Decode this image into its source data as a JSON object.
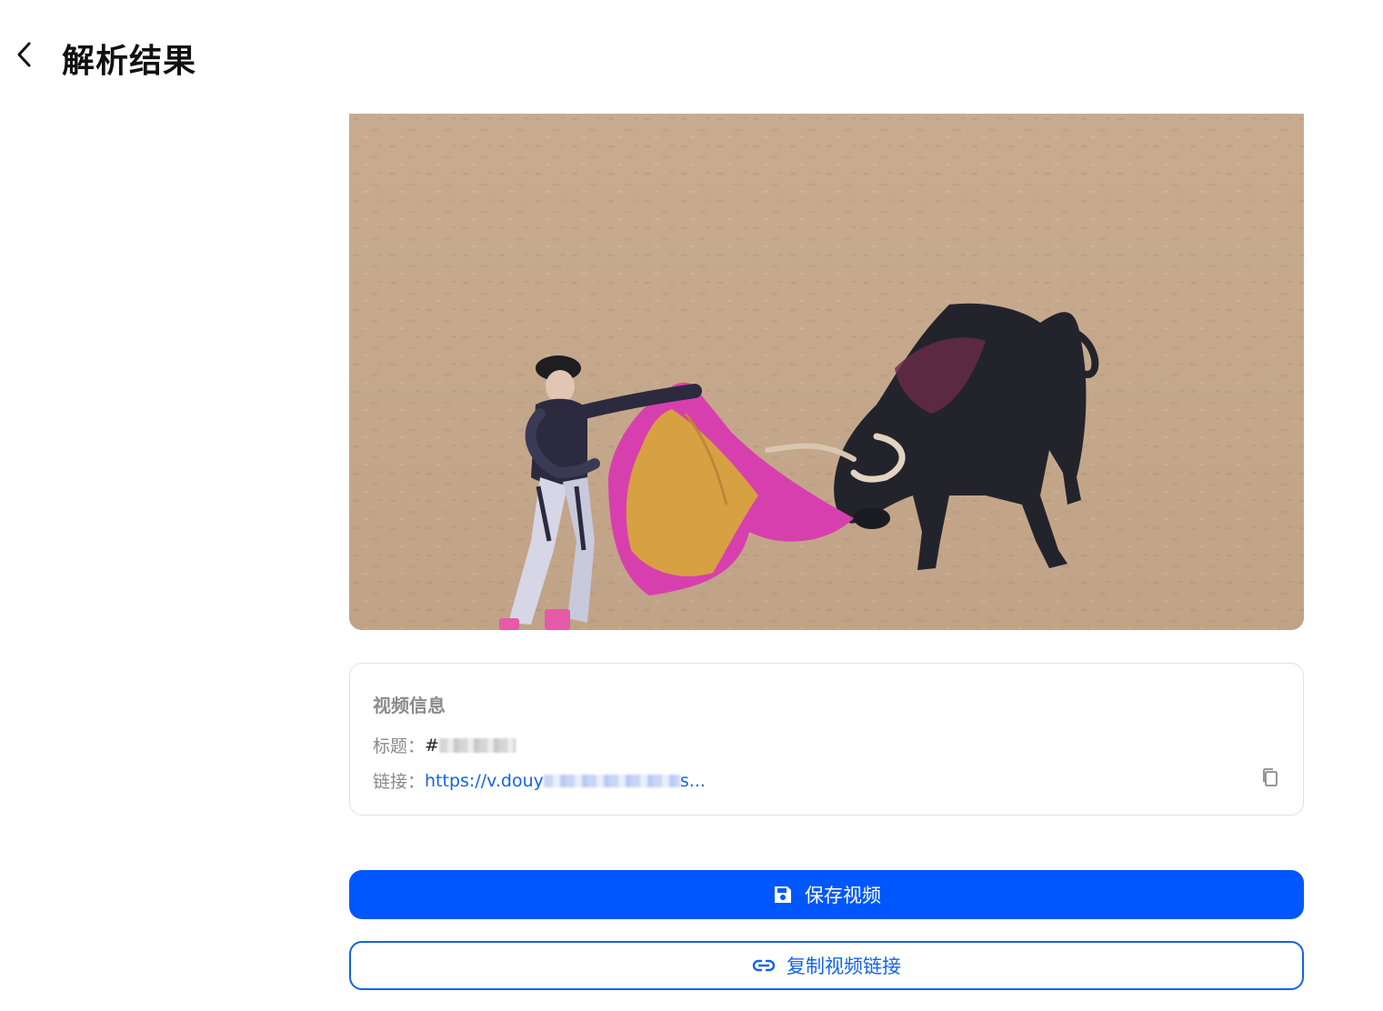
{
  "header": {
    "title": "解析结果",
    "back_icon": "chevron-left-icon"
  },
  "video": {
    "thumbnail_description_icon": "video-thumbnail"
  },
  "info": {
    "heading": "视频信息",
    "title_label": "标题：",
    "title_value_visible": "#",
    "link_label": "链接：",
    "link_prefix": "https://v.douy",
    "link_suffix": "s...",
    "copy_icon": "copy-icon"
  },
  "actions": {
    "save_label": "保存视频",
    "save_icon": "save-icon",
    "copy_link_label": "复制视频链接",
    "copy_link_icon": "link-icon"
  },
  "colors": {
    "primary": "#0057fd",
    "link": "#1463e8",
    "muted_text": "#8a8a8a"
  }
}
